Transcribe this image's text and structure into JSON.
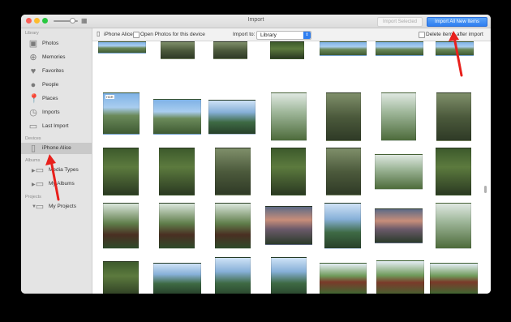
{
  "window": {
    "title": "Import"
  },
  "titlebar": {
    "import_selected": "Import Selected",
    "import_all": "Import All New Items"
  },
  "sidebar": {
    "section_library": "Library",
    "library_items": [
      {
        "label": "Photos",
        "icon": "photos-icon"
      },
      {
        "label": "Memories",
        "icon": "memories-icon"
      },
      {
        "label": "Favorites",
        "icon": "heart-icon"
      },
      {
        "label": "People",
        "icon": "person-icon"
      },
      {
        "label": "Places",
        "icon": "pin-icon"
      },
      {
        "label": "Imports",
        "icon": "clock-icon"
      },
      {
        "label": "Last Import",
        "icon": "folder-icon"
      }
    ],
    "section_devices": "Devices",
    "device": "iPhone Alice",
    "section_albums": "Albums",
    "albums": [
      {
        "label": "Media Types"
      },
      {
        "label": "My Albums"
      }
    ],
    "section_projects": "Projects",
    "projects": [
      {
        "label": "My Projects"
      }
    ]
  },
  "toolbar": {
    "device": "iPhone Alice",
    "open_photos": "Open Photos for this device",
    "import_to": "Import to:",
    "import_to_value": "Library",
    "delete_after": "Delete items after import"
  },
  "photos": {
    "hdr_badge": "HDR"
  },
  "colors": {
    "accent": "#2f7ef0",
    "annotation_arrow": "#e8201c"
  }
}
